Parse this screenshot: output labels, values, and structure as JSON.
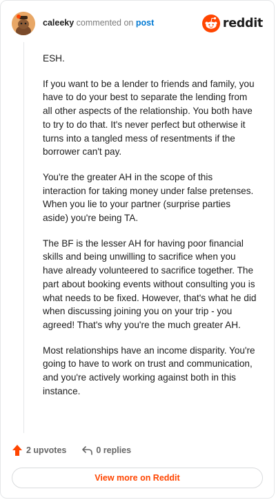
{
  "header": {
    "username": "caleeky",
    "action_text": "commented on",
    "post_link": "post",
    "brand_name": "reddit"
  },
  "comment": {
    "paragraphs": [
      "ESH.",
      "If you want to be a lender to friends and family, you have to do your best to separate the lending from all other aspects of the relationship. You both have to try to do that. It's never perfect but otherwise it turns into a tangled mess of resentments if the borrower can't pay.",
      "You're the greater AH in the scope of this interaction for taking money under false pretenses. When you lie to your partner (surprise parties aside) you're being TA.",
      "The BF is the lesser AH for having poor financial skills and being unwilling to sacrifice when you have already volunteered to sacrifice together. The part about booking events without consulting you is what needs to be fixed. However, that's what he did when discussing joining you on your trip - you agreed! That's why you're the much greater AH.",
      "Most relationships have an income disparity. You're going to have to work on trust and communication, and you're actively working against both in this instance."
    ]
  },
  "actions": {
    "upvotes": "2 upvotes",
    "replies": "0 replies"
  },
  "footer": {
    "view_more": "View more on Reddit"
  },
  "colors": {
    "accent": "#ff4500",
    "link": "#0079d3",
    "avatar": "#e8a766"
  },
  "icons": {
    "avatar": "avatar-icon",
    "brand": "reddit-logo-icon",
    "upvote": "upvote-arrow-icon",
    "reply": "reply-arrow-icon"
  }
}
